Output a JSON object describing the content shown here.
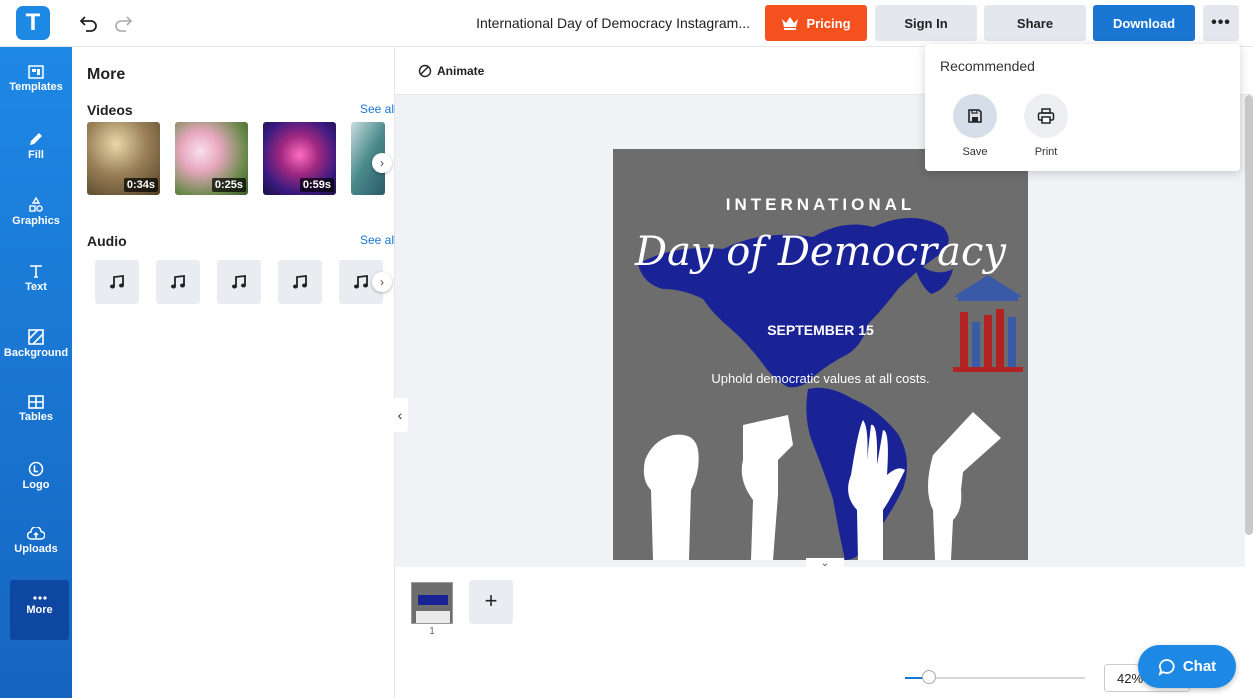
{
  "header": {
    "logo_letter": "T",
    "document_title": "International Day of Democracy Instagram...",
    "pricing_label": "Pricing",
    "signin_label": "Sign In",
    "share_label": "Share",
    "download_label": "Download",
    "more_label": "•••"
  },
  "sidebar": {
    "items": [
      {
        "label": "Templates",
        "icon": "templates-icon"
      },
      {
        "label": "Fill",
        "icon": "pencil-icon"
      },
      {
        "label": "Graphics",
        "icon": "shapes-icon"
      },
      {
        "label": "Text",
        "icon": "text-icon"
      },
      {
        "label": "Background",
        "icon": "background-icon"
      },
      {
        "label": "Tables",
        "icon": "table-icon"
      },
      {
        "label": "Logo",
        "icon": "logo-icon"
      },
      {
        "label": "Uploads",
        "icon": "upload-cloud-icon"
      },
      {
        "label": "More",
        "icon": "more-dots-icon",
        "active": true
      }
    ]
  },
  "panel": {
    "title": "More",
    "videos_title": "Videos",
    "videos_see_all": "See all",
    "videos": [
      {
        "duration": "0:34s"
      },
      {
        "duration": "0:25s"
      },
      {
        "duration": "0:59s"
      }
    ],
    "audio_title": "Audio",
    "audio_see_all": "See all"
  },
  "toolbar": {
    "animate_label": "Animate"
  },
  "design": {
    "heading": "INTERNATIONAL",
    "script_title": "Day of Democracy",
    "date": "SEPTEMBER 15",
    "tagline": "Uphold democratic values at all costs."
  },
  "pages": {
    "current": "1",
    "add_label": "+"
  },
  "zoom": {
    "value": "42%",
    "level_fraction": 0.1
  },
  "chat": {
    "label": "Chat"
  },
  "dropdown": {
    "title": "Recommended",
    "save_label": "Save",
    "print_label": "Print"
  },
  "colors": {
    "accent": "#1e88e5",
    "pricing": "#f4511e",
    "design_bg": "#6d6d6d",
    "map_blue": "#1a2396",
    "hand_red": "#b22222"
  }
}
